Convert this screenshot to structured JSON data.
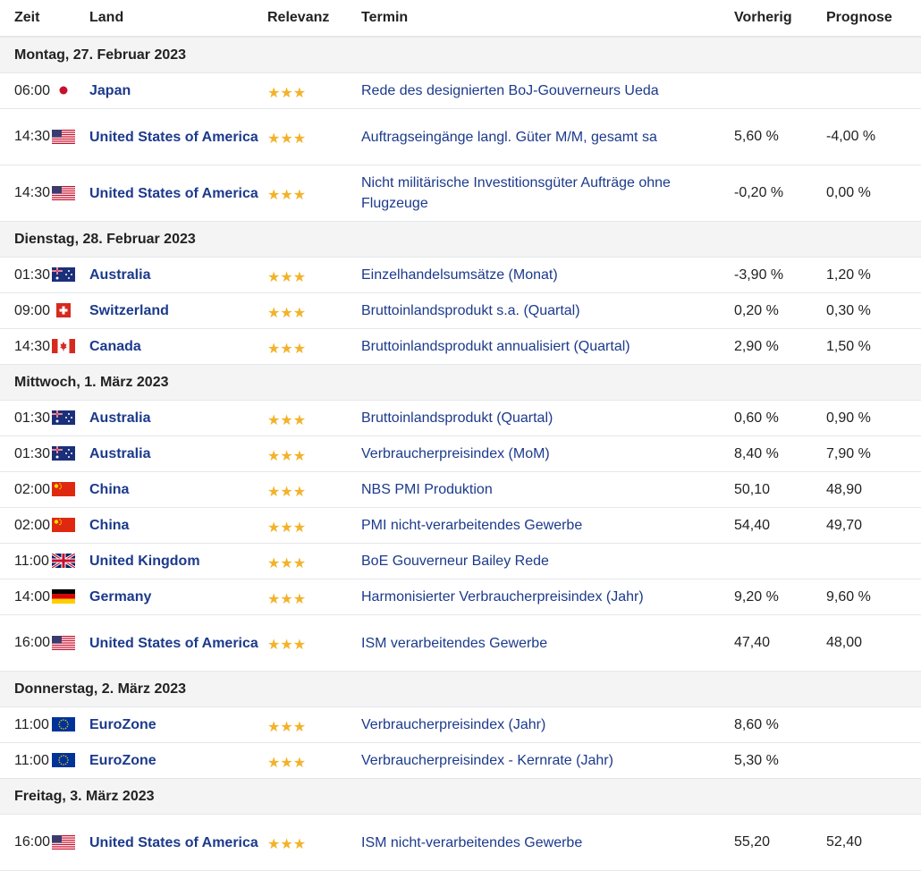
{
  "headers": {
    "zeit": "Zeit",
    "land": "Land",
    "relevanz": "Relevanz",
    "termin": "Termin",
    "vorherig": "Vorherig",
    "prognose": "Prognose"
  },
  "stars_text": "★★★",
  "colors": {
    "link": "#1c3a8c",
    "star": "#f2b32a",
    "date_bg": "#f4f4f4"
  },
  "days": [
    {
      "label": "Montag, 27. Februar 2023",
      "events": [
        {
          "time": "06:00",
          "flag": "japan-flag-icon",
          "country": "Japan",
          "event": "Rede des designierten BoJ-Gouverneurs Ueda",
          "previous": "",
          "forecast": ""
        },
        {
          "time": "14:30",
          "flag": "usa-flag-icon",
          "country": "United States of America",
          "event": "Auftragseingänge langl. Güter M/M, gesamt sa",
          "previous": "5,60 %",
          "forecast": "-4,00 %"
        },
        {
          "time": "14:30",
          "flag": "usa-flag-icon",
          "country": "United States of America",
          "event": "Nicht militärische Investitionsgüter Aufträge ohne Flugzeuge",
          "previous": "-0,20 %",
          "forecast": "0,00 %"
        }
      ]
    },
    {
      "label": "Dienstag, 28. Februar 2023",
      "events": [
        {
          "time": "01:30",
          "flag": "australia-flag-icon",
          "country": "Australia",
          "event": "Einzelhandelsumsätze (Monat)",
          "previous": "-3,90 %",
          "forecast": "1,20 %"
        },
        {
          "time": "09:00",
          "flag": "switzerland-flag-icon",
          "country": "Switzerland",
          "event": "Bruttoinlandsprodukt s.a. (Quartal)",
          "previous": "0,20 %",
          "forecast": "0,30 %"
        },
        {
          "time": "14:30",
          "flag": "canada-flag-icon",
          "country": "Canada",
          "event": "Bruttoinlandsprodukt annualisiert (Quartal)",
          "previous": "2,90 %",
          "forecast": "1,50 %"
        }
      ]
    },
    {
      "label": "Mittwoch, 1. März 2023",
      "events": [
        {
          "time": "01:30",
          "flag": "australia-flag-icon",
          "country": "Australia",
          "event": "Bruttoinlandsprodukt (Quartal)",
          "previous": "0,60 %",
          "forecast": "0,90 %"
        },
        {
          "time": "01:30",
          "flag": "australia-flag-icon",
          "country": "Australia",
          "event": "Verbraucherpreisindex (MoM)",
          "previous": "8,40 %",
          "forecast": "7,90 %"
        },
        {
          "time": "02:00",
          "flag": "china-flag-icon",
          "country": "China",
          "event": "NBS PMI Produktion",
          "previous": "50,10",
          "forecast": "48,90"
        },
        {
          "time": "02:00",
          "flag": "china-flag-icon",
          "country": "China",
          "event": "PMI nicht-verarbeitendes Gewerbe",
          "previous": "54,40",
          "forecast": "49,70"
        },
        {
          "time": "11:00",
          "flag": "uk-flag-icon",
          "country": "United Kingdom",
          "event": "BoE Gouverneur Bailey Rede",
          "previous": "",
          "forecast": ""
        },
        {
          "time": "14:00",
          "flag": "germany-flag-icon",
          "country": "Germany",
          "event": "Harmonisierter Verbraucherpreisindex (Jahr)",
          "previous": "9,20 %",
          "forecast": "9,60 %"
        },
        {
          "time": "16:00",
          "flag": "usa-flag-icon",
          "country": "United States of America",
          "event": "ISM verarbeitendes Gewerbe",
          "previous": "47,40",
          "forecast": "48,00"
        }
      ]
    },
    {
      "label": "Donnerstag, 2. März 2023",
      "events": [
        {
          "time": "11:00",
          "flag": "eu-flag-icon",
          "country": "EuroZone",
          "event": "Verbraucherpreisindex (Jahr)",
          "previous": "8,60 %",
          "forecast": ""
        },
        {
          "time": "11:00",
          "flag": "eu-flag-icon",
          "country": "EuroZone",
          "event": "Verbraucherpreisindex - Kernrate (Jahr)",
          "previous": "5,30 %",
          "forecast": ""
        }
      ]
    },
    {
      "label": "Freitag, 3. März 2023",
      "events": [
        {
          "time": "16:00",
          "flag": "usa-flag-icon",
          "country": "United States of America",
          "event": "ISM nicht-verarbeitendes Gewerbe",
          "previous": "55,20",
          "forecast": "52,40"
        }
      ]
    }
  ]
}
